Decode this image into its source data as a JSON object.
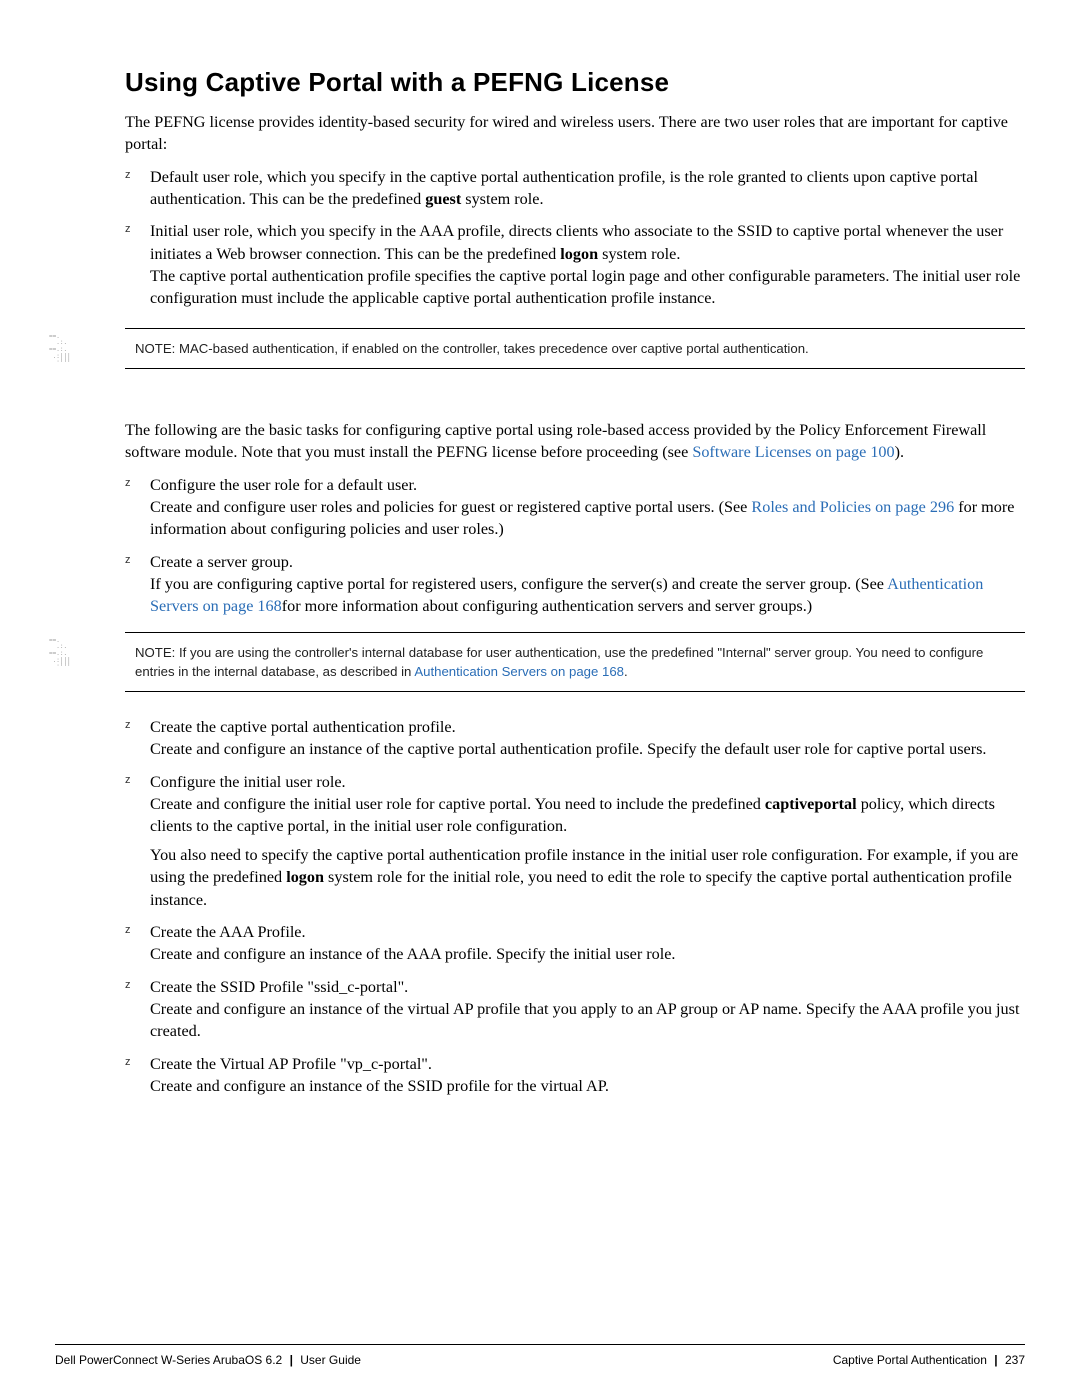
{
  "heading": "Using Captive Portal with a PEFNG License",
  "intro": "The PEFNG license provides identity-based security for wired and wireless users. There are two user roles that are important for captive portal:",
  "roles": {
    "default_a": "Default user role, which you specify in the captive portal authentication profile, is the role granted to clients upon captive portal authentication. This can be the predefined ",
    "default_bold": "guest",
    "default_b": " system role.",
    "initial_a": "Initial user role, which you specify in the AAA profile, directs clients who associate to the SSID to captive portal whenever the user initiates a Web browser connection. This can be the predefined ",
    "initial_bold": "logon",
    "initial_b": " system role.",
    "initial_body": "The captive portal authentication profile specifies the captive portal login page and other configurable parameters. The initial user role configuration must include the applicable captive portal authentication profile instance."
  },
  "note1": "NOTE: MAC-based authentication, if enabled on the controller, takes precedence over captive portal authentication.",
  "tasks_intro_a": "The following are the basic tasks for configuring captive portal using role-based access provided by the Policy Enforcement Firewall software module. Note that you must install the PEFNG license before proceeding (see ",
  "tasks_intro_link": "Software Licenses on page 100",
  "tasks_intro_b": ").",
  "tasks": {
    "t1_head": "Configure the user role for a default user.",
    "t1_body_a": "Create and configure user roles and policies for guest or registered captive portal users. (See ",
    "t1_body_link": "Roles and Policies on page 296",
    "t1_body_b": " for more information about configuring policies and user roles.)",
    "t2_head": "Create a server group.",
    "t2_body_a": "If you are configuring captive portal for registered users, configure the server(s) and create the server group. (See ",
    "t2_body_link": "Authentication Servers on page 168",
    "t2_body_b": "for more information about configuring authentication servers and server groups.)"
  },
  "note2_a": "NOTE: If you are using the controller's internal database for user authentication, use the predefined \"Internal\" server group. You need to configure entries in the internal database, as described in ",
  "note2_link": "Authentication Servers on page 168",
  "note2_b": ".",
  "tasks2": {
    "t3_head": "Create the captive portal authentication profile.",
    "t3_body": "Create and configure an instance of the captive portal authentication profile. Specify the default user role for captive portal users.",
    "t4_head": "Configure the initial user role.",
    "t4_body1_a": "Create and configure the initial user role for captive portal. You need to include the predefined ",
    "t4_body1_bold": "captiveportal",
    "t4_body1_b": " policy, which directs clients to the captive portal, in the initial user role configuration.",
    "t4_body2_a": "You also need to specify the captive portal authentication profile instance in the initial user role configuration. For example, if you are using the predefined ",
    "t4_body2_bold": "logon",
    "t4_body2_b": " system role for the initial role, you need to edit the role to specify the captive portal authentication profile instance.",
    "t5_head": "Create the AAA Profile.",
    "t5_body": "Create and configure an instance of the AAA profile. Specify the initial user role.",
    "t6_head": "Create the SSID Profile \"ssid_c-portal\".",
    "t6_body": "Create and configure an instance of the virtual AP profile that you apply to an AP group or AP name. Specify the AAA profile you just created.",
    "t7_head": "Create the Virtual AP Profile \"vp_c-portal\".",
    "t7_body": "Create and configure an instance of the SSID profile for the virtual AP."
  },
  "footer": {
    "left": "Dell PowerConnect W-Series ArubaOS 6.2",
    "left_after": "User Guide",
    "right": "Captive Portal Authentication",
    "page": "237",
    "sep": "|"
  },
  "note_icon_art": "==.  \n  .:. \n==.:. \n .:|||\n  :|||"
}
